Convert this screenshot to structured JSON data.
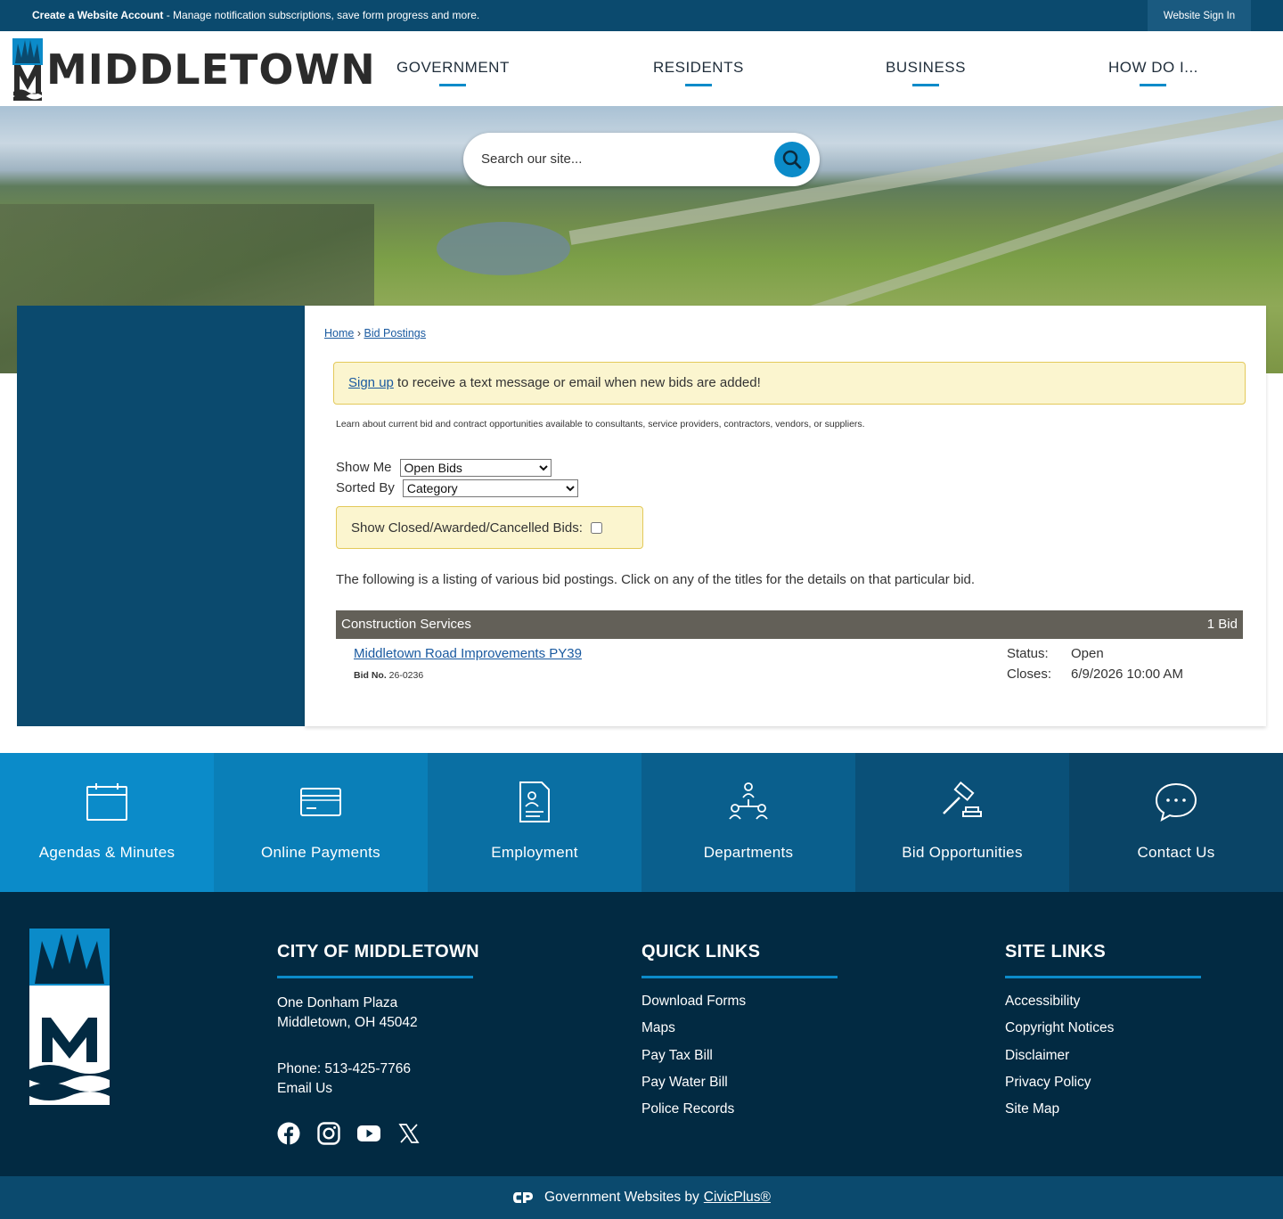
{
  "topbar": {
    "create_account": "Create a Website Account",
    "create_account_desc": " - Manage notification subscriptions, save form progress and more.",
    "sign_in": "Website Sign In"
  },
  "header": {
    "logo_text": "MIDDLETOWN",
    "nav": [
      "GOVERNMENT",
      "RESIDENTS",
      "BUSINESS",
      "HOW DO I..."
    ]
  },
  "search": {
    "placeholder": "Search our site..."
  },
  "breadcrumb": {
    "home": "Home",
    "separator": "›",
    "current": "Bid Postings"
  },
  "alert": {
    "link": "Sign up",
    "text": " to receive a text message or email when new bids are added!"
  },
  "intro": "Learn about current bid and contract opportunities available to consultants, service providers, contractors, vendors, or suppliers.",
  "filters": {
    "show_me_label": "Show Me",
    "show_me_value": "Open Bids",
    "sorted_by_label": "Sorted By",
    "sorted_by_value": "Category"
  },
  "closed_toggle": "Show Closed/Awarded/Cancelled Bids:",
  "listing_note": "The following is a listing of various bid postings. Click on any of the titles for the details on that particular bid.",
  "category": {
    "name": "Construction Services",
    "count": "1 Bid"
  },
  "bid": {
    "title": "Middletown Road Improvements PY39",
    "bid_no_label": "Bid No.",
    "bid_no": "26-0236",
    "status_label": "Status:",
    "status": "Open",
    "closes_label": "Closes:",
    "closes": "6/9/2026 10:00 AM"
  },
  "tiles": [
    {
      "label": "Agendas & Minutes",
      "icon": "calendar-icon",
      "color": "#0b8bc9"
    },
    {
      "label": "Online Payments",
      "icon": "credit-card-icon",
      "color": "#0a7fb8"
    },
    {
      "label": "Employment",
      "icon": "document-person-icon",
      "color": "#0a6fa3"
    },
    {
      "label": "Departments",
      "icon": "org-chart-icon",
      "color": "#0a5f8d"
    },
    {
      "label": "Bid Opportunities",
      "icon": "gavel-icon",
      "color": "#0a5078"
    },
    {
      "label": "Contact Us",
      "icon": "chat-bubble-icon",
      "color": "#0a4466"
    }
  ],
  "footer": {
    "city": {
      "heading": "CITY OF MIDDLETOWN",
      "address1": "One Donham Plaza",
      "address2": "Middletown, OH 45042",
      "phone": "Phone: 513-425-7766",
      "email": "Email Us"
    },
    "quick_links": {
      "heading": "QUICK LINKS",
      "items": [
        "Download Forms",
        "Maps",
        "Pay Tax Bill",
        "Pay Water Bill",
        "Police Records"
      ]
    },
    "site_links": {
      "heading": "SITE LINKS",
      "items": [
        "Accessibility",
        "Copyright Notices",
        "Disclaimer",
        "Privacy Policy",
        "Site Map"
      ]
    },
    "social": [
      "facebook-icon",
      "instagram-icon",
      "youtube-icon",
      "x-icon"
    ]
  },
  "bottombar": {
    "text": "Government Websites by",
    "link": "CivicPlus®"
  },
  "colors": {
    "navy": "#0b4a6e",
    "accent": "#0b8bc9",
    "footer": "#022a42"
  }
}
